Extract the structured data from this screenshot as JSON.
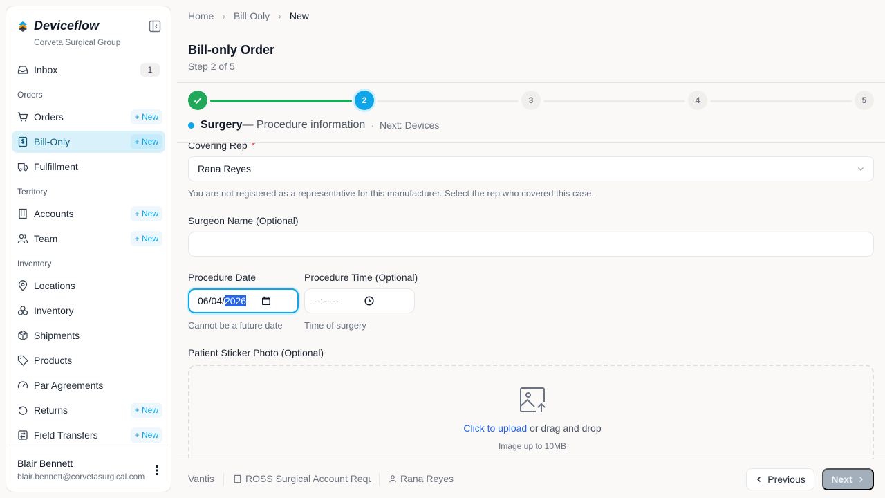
{
  "sidebar": {
    "brand": "Deviceflow",
    "org": "Corveta Surgical Group",
    "inbox": {
      "label": "Inbox",
      "count": "1"
    },
    "sections": {
      "orders": "Orders",
      "territory": "Territory",
      "inventory": "Inventory"
    },
    "new_label": "New",
    "items": {
      "orders": "Orders",
      "bill_only": "Bill-Only",
      "fulfillment": "Fulfillment",
      "accounts": "Accounts",
      "team": "Team",
      "locations": "Locations",
      "inventory": "Inventory",
      "shipments": "Shipments",
      "products": "Products",
      "par_agreements": "Par Agreements",
      "returns": "Returns",
      "field_transfers": "Field Transfers"
    },
    "user": {
      "name": "Blair Bennett",
      "email": "blair.bennett@corvetasurgical.com"
    }
  },
  "breadcrumb": {
    "home": "Home",
    "section": "Bill-Only",
    "current": "New"
  },
  "page": {
    "title": "Bill-only Order",
    "step": "Step 2 of 5"
  },
  "stepper": {
    "steps": [
      "1",
      "2",
      "3",
      "4",
      "5"
    ],
    "current_name": "Surgery",
    "current_desc": "— Procedure information",
    "separator": "·",
    "next": "Next: Devices"
  },
  "form": {
    "covering_rep": {
      "label": "Covering Rep",
      "required": "*",
      "value": "Rana Reyes",
      "help": "You are not registered as a representative for this manufacturer. Select the rep who covered this case."
    },
    "surgeon": {
      "label": "Surgeon Name (Optional)",
      "value": ""
    },
    "procedure_date": {
      "label": "Procedure Date",
      "month_day": "06/04/",
      "year": "2026",
      "help": "Cannot be a future date"
    },
    "procedure_time": {
      "label": "Procedure Time (Optional)",
      "value": "--:-- --",
      "help": "Time of surgery"
    },
    "sticker": {
      "label": "Patient Sticker Photo (Optional)",
      "link": "Click to upload",
      "text": " or drag and drop",
      "sub": "Image up to 10MB"
    }
  },
  "footer": {
    "manufacturer": "Vantis",
    "account": "ROSS Surgical Account Requ",
    "rep": "Rana Reyes",
    "prev": "Previous",
    "next": "Next"
  },
  "colors": {
    "accent": "#0ea5e9",
    "success": "#22a85a",
    "link": "#2563eb"
  }
}
